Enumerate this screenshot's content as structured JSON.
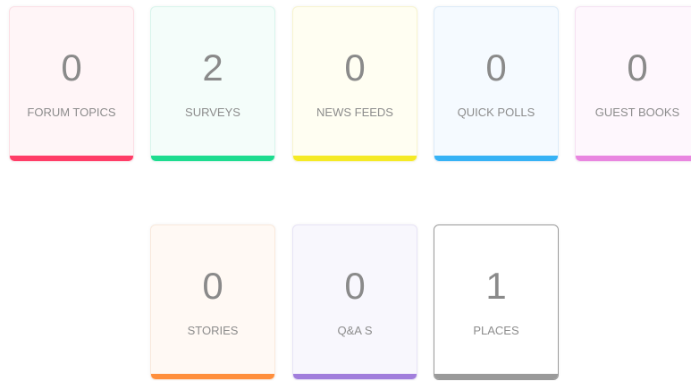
{
  "tiles": [
    {
      "id": "forum-topics",
      "count": "0",
      "label": "FORUM TOPICS",
      "bg": "#fff5f7",
      "border": "#fbdfe5",
      "accent": "#ff3d67"
    },
    {
      "id": "surveys",
      "count": "2",
      "label": "SURVEYS",
      "bg": "#f4fdfa",
      "border": "#d8f5ec",
      "accent": "#1ddc8f"
    },
    {
      "id": "news-feeds",
      "count": "0",
      "label": "NEWS FEEDS",
      "bg": "#fffef2",
      "border": "#f7f4cf",
      "accent": "#f5ea25"
    },
    {
      "id": "quick-polls",
      "count": "0",
      "label": "QUICK POLLS",
      "bg": "#f5faff",
      "border": "#dcebf8",
      "accent": "#36b2f5"
    },
    {
      "id": "guest-books",
      "count": "0",
      "label": "GUEST BOOKS",
      "bg": "#fef7fd",
      "border": "#f5e1f2",
      "accent": "#e986e0"
    },
    {
      "id": "stories",
      "count": "0",
      "label": "STORIES",
      "bg": "#fff9f4",
      "border": "#f9e9dc",
      "accent": "#ff8f3c"
    },
    {
      "id": "qas",
      "count": "0",
      "label": "Q&A S",
      "bg": "#f8f7fd",
      "border": "#e7e3f6",
      "accent": "#a17edc"
    },
    {
      "id": "places",
      "count": "1",
      "label": "PLACES",
      "bg": "#ffffff",
      "border": "#9a9a9a",
      "accent": "#9a9a9a"
    }
  ]
}
